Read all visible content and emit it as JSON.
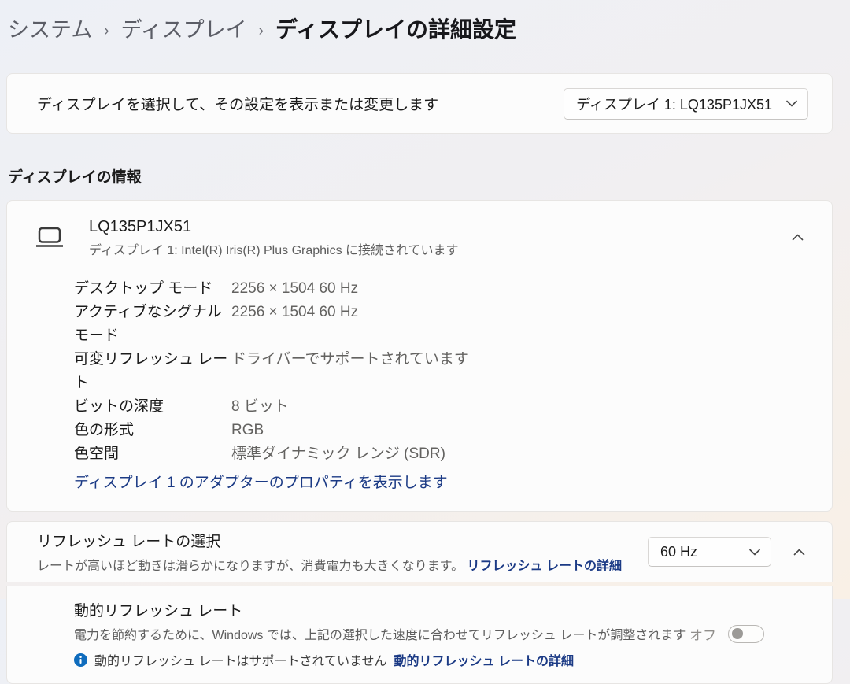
{
  "breadcrumb": {
    "items": [
      "システム",
      "ディスプレイ"
    ],
    "separator": "›",
    "current": "ディスプレイの詳細設定"
  },
  "select_display": {
    "label": "ディスプレイを選択して、その設定を表示または変更します",
    "dropdown_value": "ディスプレイ 1: LQ135P1JX51"
  },
  "display_info": {
    "section_title": "ディスプレイの情報",
    "device_name": "LQ135P1JX51",
    "device_subtitle": "ディスプレイ 1: Intel(R) Iris(R) Plus Graphics に接続されています",
    "rows": [
      {
        "label": "デスクトップ モード",
        "value": "2256 × 1504 60 Hz"
      },
      {
        "label": "アクティブなシグナル モード",
        "value": "2256 × 1504 60 Hz"
      },
      {
        "label": "可変リフレッシュ レート",
        "value": "ドライバーでサポートされています"
      },
      {
        "label": "ビットの深度",
        "value": "8 ビット"
      },
      {
        "label": "色の形式",
        "value": "RGB"
      },
      {
        "label": "色空間",
        "value": "標準ダイナミック レンジ (SDR)"
      }
    ],
    "adapter_link": "ディスプレイ 1 のアダプターのプロパティを表示します"
  },
  "refresh_rate": {
    "title": "リフレッシュ レートの選択",
    "description": "レートが高いほど動きは滑らかになりますが、消費電力も大きくなります。",
    "link": "リフレッシュ レートの詳細",
    "dropdown_value": "60 Hz"
  },
  "dynamic_refresh": {
    "title": "動的リフレッシュ レート",
    "description": "電力を節約するために、Windows では、上記の選択した速度に合わせてリフレッシュ レートが調整されます",
    "status": "動的リフレッシュ レートはサポートされていません",
    "link": "動的リフレッシュ レートの詳細",
    "toggle_label": "オフ",
    "toggle_state": "off"
  },
  "colors": {
    "link_navy": "#1b3a85",
    "info_icon_blue": "#0f6cbd",
    "card_bg": "#fcfcfc",
    "bg_top": "#edf0f6",
    "bg_bottom": "#f9f0e6"
  }
}
